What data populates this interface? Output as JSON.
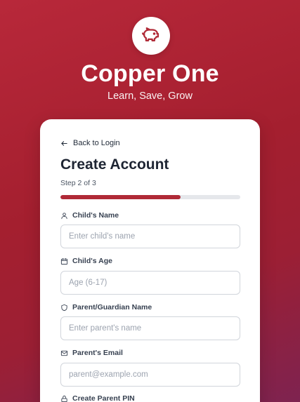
{
  "brand": {
    "name": "Copper One",
    "tagline": "Learn, Save, Grow",
    "logo_icon": "piggy-bank-icon",
    "colors": {
      "primary": "#b02a37",
      "gradient_start": "#b8283a",
      "gradient_end": "#7e2350",
      "text_dark": "#1e2533",
      "progress_track": "#e5e7eb"
    }
  },
  "form": {
    "back_label": "Back to Login",
    "title": "Create Account",
    "step_text": "Step 2 of 3",
    "progress_fraction": 0.667,
    "fields": [
      {
        "label": "Child's Name",
        "icon": "user-icon",
        "placeholder": "Enter child's name",
        "value": ""
      },
      {
        "label": "Child's Age",
        "icon": "calendar-icon",
        "placeholder": "Age (6-17)",
        "value": ""
      },
      {
        "label": "Parent/Guardian Name",
        "icon": "shield-icon",
        "placeholder": "Enter parent's name",
        "value": ""
      },
      {
        "label": "Parent's Email",
        "icon": "mail-icon",
        "placeholder": "parent@example.com",
        "value": ""
      },
      {
        "label": "Create Parent PIN",
        "icon": "lock-icon"
      }
    ]
  }
}
